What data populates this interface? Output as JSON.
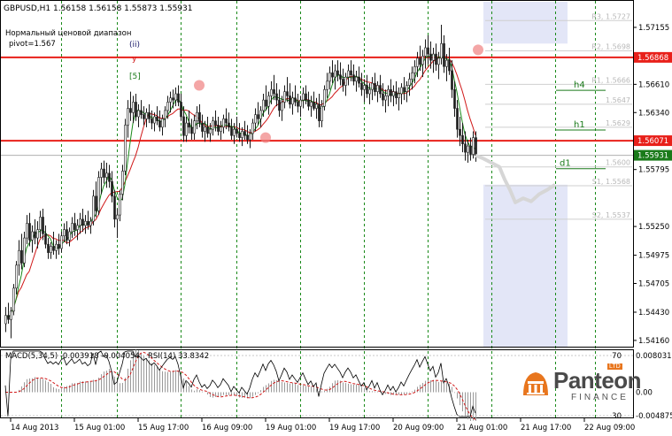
{
  "chart_data": {
    "type": "candlestick",
    "symbol_header": "GBPUSD,H1  1.56158 1.56158 1.55873 1.55931",
    "notes": [
      "Нормальный ценовой диапазон",
      "pivot=1.567"
    ],
    "wave_labels": [
      "(ii)",
      "y",
      "[5]"
    ],
    "price_axis": {
      "ylim": [
        1.541,
        1.574
      ],
      "ticks": [
        "1.57155",
        "1.56610",
        "1.56340",
        "1.55795",
        "1.55250",
        "1.54975",
        "1.54705",
        "1.54430",
        "1.54160"
      ],
      "tick_values": [
        1.57155,
        1.5661,
        1.5634,
        1.55795,
        1.5525,
        1.54975,
        1.54705,
        1.5443,
        1.5416
      ]
    },
    "price_badges": [
      {
        "label": "1.56868",
        "value": 1.56868,
        "color": "#e8201a"
      },
      {
        "label": "1.56071",
        "value": 1.56071,
        "color": "#e8201a"
      },
      {
        "label": "1.55931",
        "value": 1.55931,
        "color": "#1a7a1a"
      }
    ],
    "horizontal_lines": [
      {
        "value": 1.56868,
        "color": "#e8201a"
      },
      {
        "value": 1.56071,
        "color": "#e8201a"
      },
      {
        "value": 1.55931,
        "color": "#b0b0b0"
      }
    ],
    "level_labels": [
      {
        "label": "h4",
        "value": 1.5657,
        "color": "#1a7a1a"
      },
      {
        "label": "h1",
        "value": 1.5619,
        "color": "#1a7a1a"
      },
      {
        "label": "d1",
        "value": 1.5582,
        "color": "#1a7a1a"
      }
    ],
    "pivot_levels": [
      {
        "label": "R3, 1.5727",
        "value": 1.5722
      },
      {
        "label": "R2, 1.5698",
        "value": 1.5693
      },
      {
        "label": "R1, 1.5666",
        "value": 1.5661
      },
      {
        "label": "1.5647",
        "value": 1.5642
      },
      {
        "label": "1.5629",
        "value": 1.562
      },
      {
        "label": "1.5600",
        "value": 1.5582
      },
      {
        "label": "S1, 1.5568",
        "value": 1.5564
      },
      {
        "label": "S2, 1.5537",
        "value": 1.5532
      }
    ],
    "x_axis": {
      "labels": [
        "14 Aug 2013",
        "15 Aug 01:00",
        "15 Aug 17:00",
        "16 Aug 09:00",
        "19 Aug 01:00",
        "19 Aug 17:00",
        "20 Aug 09:00",
        "21 Aug 01:00",
        "21 Aug 17:00",
        "22 Aug 09:00"
      ],
      "label_bar_index": [
        2,
        26,
        50,
        74,
        98,
        122,
        146,
        170,
        194,
        218
      ]
    },
    "day_separator_bars": [
      21,
      42,
      66,
      87,
      111,
      135,
      159,
      183,
      207,
      222
    ],
    "candles": [
      [
        1.5432,
        1.5448,
        1.5424,
        1.544
      ],
      [
        1.544,
        1.5452,
        1.5432,
        1.5436
      ],
      [
        1.5436,
        1.5448,
        1.5418,
        1.5444
      ],
      [
        1.5444,
        1.547,
        1.544,
        1.5466
      ],
      [
        1.5466,
        1.5492,
        1.546,
        1.5488
      ],
      [
        1.5488,
        1.5512,
        1.5478,
        1.5502
      ],
      [
        1.5502,
        1.5518,
        1.5484,
        1.549
      ],
      [
        1.549,
        1.552,
        1.5486,
        1.5514
      ],
      [
        1.5514,
        1.5536,
        1.5508,
        1.5528
      ],
      [
        1.5528,
        1.5538,
        1.5506,
        1.5512
      ],
      [
        1.5512,
        1.5526,
        1.55,
        1.552
      ],
      [
        1.552,
        1.5532,
        1.5508,
        1.5514
      ],
      [
        1.5514,
        1.553,
        1.5504,
        1.5522
      ],
      [
        1.5522,
        1.554,
        1.5514,
        1.5534
      ],
      [
        1.5534,
        1.5542,
        1.5512,
        1.5518
      ],
      [
        1.5518,
        1.5526,
        1.5504,
        1.5508
      ],
      [
        1.5508,
        1.5514,
        1.5494,
        1.55
      ],
      [
        1.55,
        1.551,
        1.5494,
        1.5506
      ],
      [
        1.5506,
        1.552,
        1.5498,
        1.5502
      ],
      [
        1.5502,
        1.5512,
        1.5494,
        1.5508
      ],
      [
        1.5508,
        1.5518,
        1.5498,
        1.5504
      ],
      [
        1.5504,
        1.552,
        1.55,
        1.5516
      ],
      [
        1.5516,
        1.5528,
        1.551,
        1.5522
      ],
      [
        1.5522,
        1.553,
        1.5508,
        1.5512
      ],
      [
        1.5512,
        1.5524,
        1.5506,
        1.552
      ],
      [
        1.552,
        1.5534,
        1.5514,
        1.5528
      ],
      [
        1.5528,
        1.5538,
        1.5516,
        1.5522
      ],
      [
        1.5522,
        1.5532,
        1.5512,
        1.5526
      ],
      [
        1.5526,
        1.5538,
        1.5518,
        1.5532
      ],
      [
        1.5532,
        1.5542,
        1.552,
        1.5526
      ],
      [
        1.5526,
        1.5536,
        1.5518,
        1.553
      ],
      [
        1.553,
        1.554,
        1.5522,
        1.5526
      ],
      [
        1.5526,
        1.5534,
        1.5518,
        1.553
      ],
      [
        1.553,
        1.556,
        1.5526,
        1.5554
      ],
      [
        1.5554,
        1.5568,
        1.5534,
        1.554
      ],
      [
        1.554,
        1.5578,
        1.5536,
        1.5572
      ],
      [
        1.5572,
        1.5586,
        1.5556,
        1.558
      ],
      [
        1.558,
        1.5588,
        1.5566,
        1.5572
      ],
      [
        1.5572,
        1.5586,
        1.5562,
        1.5576
      ],
      [
        1.5576,
        1.5584,
        1.5562,
        1.5568
      ],
      [
        1.5568,
        1.5578,
        1.5548,
        1.5554
      ],
      [
        1.5554,
        1.556,
        1.5524,
        1.5532
      ],
      [
        1.5532,
        1.5542,
        1.5514,
        1.5536
      ],
      [
        1.5536,
        1.556,
        1.553,
        1.5556
      ],
      [
        1.5556,
        1.5584,
        1.555,
        1.5578
      ],
      [
        1.5578,
        1.5628,
        1.5574,
        1.5622
      ],
      [
        1.5622,
        1.5646,
        1.561,
        1.5638
      ],
      [
        1.5638,
        1.5654,
        1.5626,
        1.5634
      ],
      [
        1.5634,
        1.565,
        1.5624,
        1.5644
      ],
      [
        1.5644,
        1.5652,
        1.5626,
        1.563
      ],
      [
        1.563,
        1.5642,
        1.562,
        1.5636
      ],
      [
        1.5636,
        1.5646,
        1.5628,
        1.5632
      ],
      [
        1.5632,
        1.564,
        1.5622,
        1.5628
      ],
      [
        1.5628,
        1.5638,
        1.562,
        1.5634
      ],
      [
        1.5634,
        1.5642,
        1.5624,
        1.5628
      ],
      [
        1.5628,
        1.5636,
        1.5618,
        1.5624
      ],
      [
        1.5624,
        1.5634,
        1.5616,
        1.563
      ],
      [
        1.563,
        1.564,
        1.5622,
        1.5626
      ],
      [
        1.5626,
        1.5636,
        1.5616,
        1.562
      ],
      [
        1.562,
        1.5632,
        1.5612,
        1.5628
      ],
      [
        1.5628,
        1.564,
        1.562,
        1.5636
      ],
      [
        1.5636,
        1.565,
        1.5628,
        1.5644
      ],
      [
        1.5644,
        1.5654,
        1.5634,
        1.5648
      ],
      [
        1.5648,
        1.5656,
        1.5638,
        1.5646
      ],
      [
        1.5646,
        1.5658,
        1.564,
        1.5652
      ],
      [
        1.5652,
        1.566,
        1.564,
        1.5644
      ],
      [
        1.5644,
        1.5652,
        1.5626,
        1.563
      ],
      [
        1.563,
        1.564,
        1.5606,
        1.5612
      ],
      [
        1.5612,
        1.563,
        1.5606,
        1.5624
      ],
      [
        1.5624,
        1.5636,
        1.5614,
        1.562
      ],
      [
        1.562,
        1.5628,
        1.5608,
        1.5614
      ],
      [
        1.5614,
        1.5632,
        1.5608,
        1.5626
      ],
      [
        1.5626,
        1.564,
        1.5618,
        1.5634
      ],
      [
        1.5634,
        1.5642,
        1.562,
        1.5624
      ],
      [
        1.5624,
        1.5632,
        1.561,
        1.5616
      ],
      [
        1.5616,
        1.5626,
        1.5606,
        1.562
      ],
      [
        1.562,
        1.563,
        1.561,
        1.5614
      ],
      [
        1.5614,
        1.5624,
        1.5606,
        1.5618
      ],
      [
        1.5618,
        1.563,
        1.5612,
        1.5626
      ],
      [
        1.5626,
        1.5636,
        1.5616,
        1.5622
      ],
      [
        1.5622,
        1.563,
        1.5612,
        1.5616
      ],
      [
        1.5616,
        1.5626,
        1.5608,
        1.562
      ],
      [
        1.562,
        1.5632,
        1.5614,
        1.5628
      ],
      [
        1.5628,
        1.5638,
        1.5618,
        1.5624
      ],
      [
        1.5624,
        1.5634,
        1.5616,
        1.562
      ],
      [
        1.562,
        1.5628,
        1.5608,
        1.5612
      ],
      [
        1.5612,
        1.5624,
        1.5604,
        1.5618
      ],
      [
        1.5618,
        1.563,
        1.561,
        1.5614
      ],
      [
        1.5614,
        1.5624,
        1.5606,
        1.561
      ],
      [
        1.561,
        1.562,
        1.5602,
        1.5616
      ],
      [
        1.5616,
        1.5626,
        1.5608,
        1.5612
      ],
      [
        1.5612,
        1.5622,
        1.5604,
        1.5608
      ],
      [
        1.5608,
        1.5618,
        1.56,
        1.5614
      ],
      [
        1.5614,
        1.5628,
        1.5608,
        1.5624
      ],
      [
        1.5624,
        1.5638,
        1.5616,
        1.5632
      ],
      [
        1.5632,
        1.5644,
        1.5622,
        1.5628
      ],
      [
        1.5628,
        1.564,
        1.562,
        1.5636
      ],
      [
        1.5636,
        1.5652,
        1.563,
        1.5646
      ],
      [
        1.5646,
        1.566,
        1.5636,
        1.564
      ],
      [
        1.564,
        1.5654,
        1.5632,
        1.565
      ],
      [
        1.565,
        1.5664,
        1.5642,
        1.5656
      ],
      [
        1.5656,
        1.567,
        1.5646,
        1.5652
      ],
      [
        1.5652,
        1.5662,
        1.564,
        1.5646
      ],
      [
        1.5646,
        1.5656,
        1.563,
        1.5636
      ],
      [
        1.5636,
        1.565,
        1.5626,
        1.5644
      ],
      [
        1.5644,
        1.566,
        1.5638,
        1.5654
      ],
      [
        1.5654,
        1.5668,
        1.5644,
        1.565
      ],
      [
        1.565,
        1.5662,
        1.5638,
        1.5642
      ],
      [
        1.5642,
        1.5654,
        1.5632,
        1.5648
      ],
      [
        1.5648,
        1.566,
        1.564,
        1.5644
      ],
      [
        1.5644,
        1.5652,
        1.5634,
        1.564
      ],
      [
        1.564,
        1.565,
        1.563,
        1.5646
      ],
      [
        1.5646,
        1.5658,
        1.5638,
        1.5652
      ],
      [
        1.5652,
        1.566,
        1.5642,
        1.5646
      ],
      [
        1.5646,
        1.5654,
        1.5636,
        1.564
      ],
      [
        1.564,
        1.565,
        1.563,
        1.5644
      ],
      [
        1.5644,
        1.5654,
        1.5636,
        1.5638
      ],
      [
        1.5638,
        1.5648,
        1.5628,
        1.5642
      ],
      [
        1.5642,
        1.5652,
        1.562,
        1.5626
      ],
      [
        1.5626,
        1.5646,
        1.562,
        1.564
      ],
      [
        1.564,
        1.566,
        1.5636,
        1.5656
      ],
      [
        1.5656,
        1.5672,
        1.5648,
        1.5664
      ],
      [
        1.5664,
        1.5678,
        1.5656,
        1.5672
      ],
      [
        1.5672,
        1.5684,
        1.5662,
        1.5668
      ],
      [
        1.5668,
        1.568,
        1.5656,
        1.5674
      ],
      [
        1.5674,
        1.5684,
        1.5664,
        1.567
      ],
      [
        1.567,
        1.5682,
        1.566,
        1.5666
      ],
      [
        1.5666,
        1.5676,
        1.5654,
        1.566
      ],
      [
        1.566,
        1.5672,
        1.565,
        1.5668
      ],
      [
        1.5668,
        1.568,
        1.566,
        1.5674
      ],
      [
        1.5674,
        1.5684,
        1.5664,
        1.567
      ],
      [
        1.567,
        1.568,
        1.566,
        1.5664
      ],
      [
        1.5664,
        1.5674,
        1.5654,
        1.5668
      ],
      [
        1.5668,
        1.5678,
        1.5658,
        1.5662
      ],
      [
        1.5662,
        1.5672,
        1.565,
        1.5656
      ],
      [
        1.5656,
        1.5666,
        1.5644,
        1.566
      ],
      [
        1.566,
        1.567,
        1.5648,
        1.5652
      ],
      [
        1.5652,
        1.5662,
        1.5642,
        1.5656
      ],
      [
        1.5656,
        1.5668,
        1.5646,
        1.5662
      ],
      [
        1.5662,
        1.5672,
        1.565,
        1.5654
      ],
      [
        1.5654,
        1.5664,
        1.5644,
        1.566
      ],
      [
        1.566,
        1.567,
        1.5648,
        1.5652
      ],
      [
        1.5652,
        1.5662,
        1.564,
        1.5646
      ],
      [
        1.5646,
        1.5656,
        1.5634,
        1.565
      ],
      [
        1.565,
        1.566,
        1.564,
        1.5656
      ],
      [
        1.5656,
        1.5666,
        1.5644,
        1.565
      ],
      [
        1.565,
        1.566,
        1.564,
        1.5654
      ],
      [
        1.5654,
        1.5664,
        1.5642,
        1.5648
      ],
      [
        1.5648,
        1.5658,
        1.5636,
        1.5652
      ],
      [
        1.5652,
        1.5662,
        1.5642,
        1.5658
      ],
      [
        1.5658,
        1.5668,
        1.5646,
        1.5654
      ],
      [
        1.5654,
        1.5664,
        1.5644,
        1.566
      ],
      [
        1.566,
        1.5672,
        1.565,
        1.5666
      ],
      [
        1.5666,
        1.5678,
        1.5656,
        1.5672
      ],
      [
        1.5672,
        1.5684,
        1.5662,
        1.5678
      ],
      [
        1.5678,
        1.5692,
        1.5668,
        1.5686
      ],
      [
        1.5686,
        1.5698,
        1.5674,
        1.568
      ],
      [
        1.568,
        1.5694,
        1.5668,
        1.5688
      ],
      [
        1.5688,
        1.5704,
        1.5676,
        1.5696
      ],
      [
        1.5696,
        1.5708,
        1.568,
        1.569
      ],
      [
        1.569,
        1.5702,
        1.5676,
        1.5684
      ],
      [
        1.5684,
        1.5696,
        1.5672,
        1.569
      ],
      [
        1.569,
        1.57,
        1.5674,
        1.568
      ],
      [
        1.568,
        1.5692,
        1.5666,
        1.5686
      ],
      [
        1.5686,
        1.5718,
        1.568,
        1.57
      ],
      [
        1.57,
        1.5708,
        1.5672,
        1.5678
      ],
      [
        1.5678,
        1.569,
        1.5664,
        1.5684
      ],
      [
        1.5684,
        1.5696,
        1.567,
        1.5674
      ],
      [
        1.5674,
        1.5684,
        1.5648,
        1.5656
      ],
      [
        1.5656,
        1.5664,
        1.563,
        1.5638
      ],
      [
        1.5638,
        1.5646,
        1.561,
        1.5618
      ],
      [
        1.5618,
        1.563,
        1.5602,
        1.5612
      ],
      [
        1.5612,
        1.5624,
        1.5596,
        1.5604
      ],
      [
        1.5604,
        1.5616,
        1.5588,
        1.5596
      ],
      [
        1.5596,
        1.5608,
        1.5586,
        1.5602
      ],
      [
        1.5602,
        1.561,
        1.5588,
        1.5594
      ],
      [
        1.5594,
        1.5616,
        1.559,
        1.561
      ],
      [
        1.561,
        1.5616,
        1.5587,
        1.5593
      ]
    ],
    "ghost_path": [
      [
        1.5593,
        0
      ],
      [
        1.559,
        3
      ],
      [
        1.5586,
        6
      ],
      [
        1.5582,
        9
      ],
      [
        1.557,
        11
      ],
      [
        1.556,
        13
      ],
      [
        1.5548,
        15
      ],
      [
        1.5552,
        18
      ],
      [
        1.5549,
        21
      ],
      [
        1.5556,
        24
      ],
      [
        1.556,
        27
      ],
      [
        1.5565,
        30
      ]
    ],
    "macd": {
      "label": "MACD(5,34,5) -0.003918 -0.004054",
      "ylim": [
        -0.0048,
        0.0081
      ],
      "ticks": [
        "0.008031",
        "0.00",
        "-0.004875"
      ],
      "tick_values": [
        0.008031,
        0.0,
        -0.004875
      ]
    },
    "rsi": {
      "label": "RSI(14) 33.8342",
      "ylim": [
        30,
        72
      ],
      "ticks": [
        "70",
        "30"
      ],
      "tick_values": [
        70,
        30
      ]
    },
    "logo": {
      "name": "Panteon",
      "sub": "FINANCE",
      "badge": "LTD"
    },
    "colors": {
      "grid_dashed": "#1a8a1a",
      "candle": "#1a1a1a",
      "ma_fast": "#1a8a1a",
      "ma_slow": "#d01818",
      "highlight": "#e8201a",
      "zone": "#e3e6f7",
      "marker": "#f08080",
      "rsi": "#000000",
      "macd_signal": "#d01818"
    }
  }
}
